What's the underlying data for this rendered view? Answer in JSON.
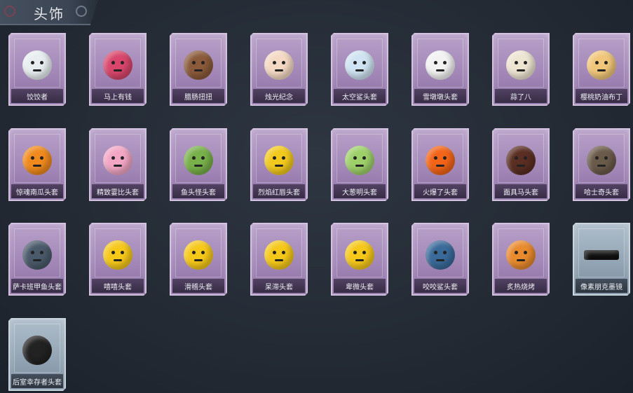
{
  "header": {
    "title": "头饰"
  },
  "items": [
    {
      "label": "饺饺者",
      "icon": "dumpling-head-icon",
      "color": "#e8eef0",
      "frame": "purple"
    },
    {
      "label": "马上有钱",
      "icon": "horse-head-icon",
      "color": "#d8466c",
      "frame": "purple"
    },
    {
      "label": "腊肠扭扭",
      "icon": "dachshund-head-icon",
      "color": "#8a5a3a",
      "frame": "purple"
    },
    {
      "label": "烛光纪念",
      "icon": "candle-head-icon",
      "color": "#f4d9c4",
      "frame": "purple"
    },
    {
      "label": "太空鲨头套",
      "icon": "space-shark-head-icon",
      "color": "#cfe3f2",
      "frame": "purple"
    },
    {
      "label": "雪墩墩头套",
      "icon": "snowman-head-icon",
      "color": "#f2f2f2",
      "frame": "purple"
    },
    {
      "label": "蒜了八",
      "icon": "garlic-head-icon",
      "color": "#ede4d2",
      "frame": "purple"
    },
    {
      "label": "樱桃奶油布丁",
      "icon": "pudding-head-icon",
      "color": "#f0c67a",
      "frame": "purple"
    },
    {
      "label": "惊魂南瓜头套",
      "icon": "pumpkin-head-icon",
      "color": "#f08a1e",
      "frame": "purple"
    },
    {
      "label": "精致霎比头套",
      "icon": "pink-pig-head-icon",
      "color": "#f2a6c4",
      "frame": "purple"
    },
    {
      "label": "鱼头怪头套",
      "icon": "fish-monster-head-icon",
      "color": "#78b04a",
      "frame": "purple"
    },
    {
      "label": "烈焰红唇头套",
      "icon": "yellow-mouse-head-icon",
      "color": "#f2c91e",
      "frame": "purple"
    },
    {
      "label": "大葱明头套",
      "icon": "scallion-head-icon",
      "color": "#9ed06a",
      "frame": "purple"
    },
    {
      "label": "火爆了头套",
      "icon": "fire-head-icon",
      "color": "#f26418",
      "frame": "purple"
    },
    {
      "label": "面具马头套",
      "icon": "horse-mask-head-icon",
      "color": "#5a2e22",
      "frame": "purple"
    },
    {
      "label": "哈士奇头套",
      "icon": "husky-head-icon",
      "color": "#6a5a4a",
      "frame": "purple"
    },
    {
      "label": "萨卡班甲鱼头套",
      "icon": "whale-fish-head-icon",
      "color": "#4a5a6a",
      "frame": "purple"
    },
    {
      "label": "嘻嘻头套",
      "icon": "grin-emoji-head-icon",
      "color": "#f6c81a",
      "frame": "purple"
    },
    {
      "label": "滑稽头套",
      "icon": "funny-emoji-head-icon",
      "color": "#f6c81a",
      "frame": "purple"
    },
    {
      "label": "呆滞头套",
      "icon": "dull-emoji-head-icon",
      "color": "#f6c81a",
      "frame": "purple"
    },
    {
      "label": "卑微头套",
      "icon": "humble-emoji-head-icon",
      "color": "#f6c81a",
      "frame": "purple"
    },
    {
      "label": "咬咬鲨头套",
      "icon": "shark-head-icon",
      "color": "#3a6a9a",
      "frame": "purple"
    },
    {
      "label": "炙热烧烤",
      "icon": "bbq-toast-head-icon",
      "color": "#e88a2e",
      "frame": "purple"
    },
    {
      "label": "像素朋克墨镜",
      "icon": "pixel-sunglasses-icon",
      "color": "#111111",
      "frame": "blue"
    },
    {
      "label": "后室幸存者头套",
      "icon": "gas-mask-helmet-icon",
      "color": "#222222",
      "frame": "blue"
    }
  ]
}
